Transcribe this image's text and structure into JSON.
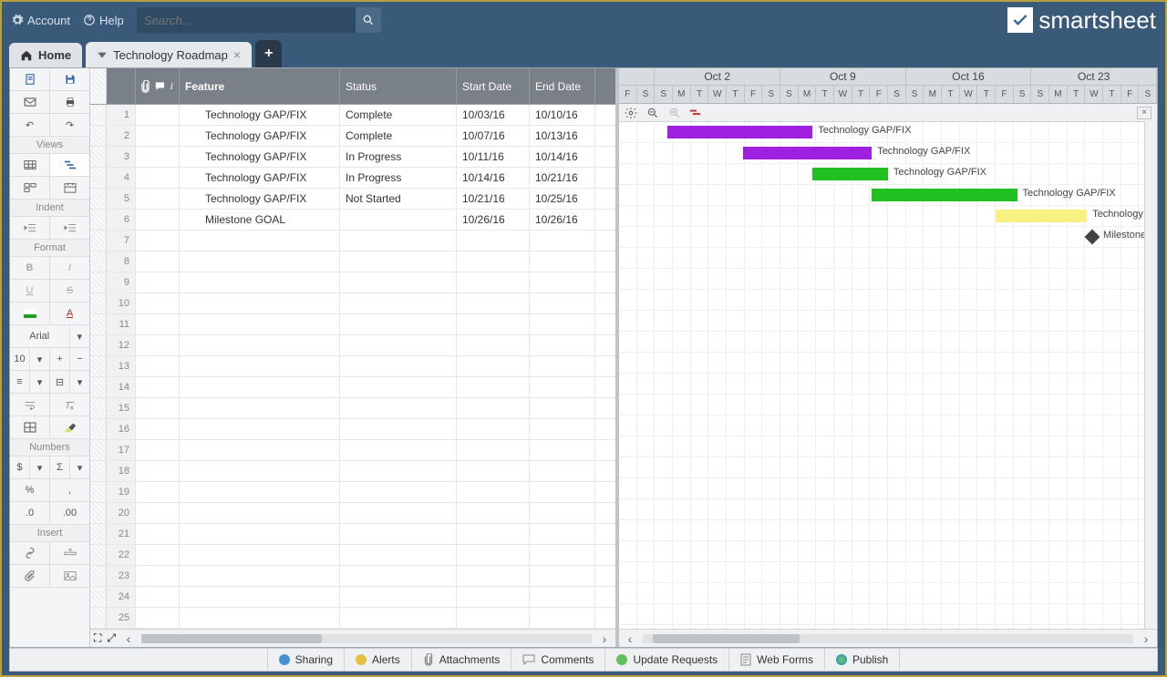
{
  "topbar": {
    "account": "Account",
    "help": "Help",
    "search_placeholder": "Search..."
  },
  "brand": {
    "name": "smartsheet"
  },
  "tabs": {
    "home": "Home",
    "sheet": "Technology Roadmap"
  },
  "sidebar": {
    "views_label": "Views",
    "indent_label": "Indent",
    "format_label": "Format",
    "numbers_label": "Numbers",
    "insert_label": "Insert",
    "font": "Arial",
    "fontsize": "10"
  },
  "grid": {
    "columns": {
      "feature": "Feature",
      "status": "Status",
      "start": "Start Date",
      "end": "End Date"
    },
    "rows": [
      {
        "n": 1,
        "feature": "Technology GAP/FIX",
        "status": "Complete",
        "start": "10/03/16",
        "end": "10/10/16"
      },
      {
        "n": 2,
        "feature": "Technology GAP/FIX",
        "status": "Complete",
        "start": "10/07/16",
        "end": "10/13/16"
      },
      {
        "n": 3,
        "feature": "Technology GAP/FIX",
        "status": "In Progress",
        "start": "10/11/16",
        "end": "10/14/16"
      },
      {
        "n": 4,
        "feature": "Technology GAP/FIX",
        "status": "In Progress",
        "start": "10/14/16",
        "end": "10/21/16"
      },
      {
        "n": 5,
        "feature": "Technology GAP/FIX",
        "status": "Not Started",
        "start": "10/21/16",
        "end": "10/25/16"
      },
      {
        "n": 6,
        "feature": "Milestone GOAL",
        "status": "",
        "start": "10/26/16",
        "end": "10/26/16"
      }
    ],
    "blank_rows_to": 25
  },
  "gantt": {
    "weeks": [
      "Oct 2",
      "Oct 9",
      "Oct 16",
      "Oct 23"
    ],
    "days": [
      "F",
      "S",
      "S",
      "M",
      "T",
      "W",
      "T",
      "F",
      "S",
      "S",
      "M",
      "T",
      "W",
      "T",
      "F",
      "S",
      "S",
      "M",
      "T",
      "W",
      "T",
      "F",
      "S",
      "S",
      "M",
      "T",
      "W",
      "T",
      "F",
      "S"
    ],
    "bars": [
      {
        "row": 0,
        "left_pct": 9,
        "width_pct": 27,
        "color": "#a020e0",
        "label": "Technology GAP/FIX"
      },
      {
        "row": 1,
        "left_pct": 23,
        "width_pct": 24,
        "color": "#a020e0",
        "label": "Technology GAP/FIX"
      },
      {
        "row": 2,
        "left_pct": 36,
        "width_pct": 14,
        "color": "#20c020",
        "label": "Technology GAP/FIX"
      },
      {
        "row": 3,
        "left_pct": 47,
        "width_pct": 27,
        "color": "#20c020",
        "label": "Technology GAP/FIX"
      },
      {
        "row": 4,
        "left_pct": 70,
        "width_pct": 17,
        "color": "#f8f080",
        "label": "Technology GAP/FIX",
        "label_cut": "Technology G"
      },
      {
        "row": 5,
        "left_pct": 87,
        "diamond": true,
        "label": "Milestone GOAL",
        "label_cut": "Milestone G"
      }
    ]
  },
  "bottom": {
    "sharing": "Sharing",
    "alerts": "Alerts",
    "attachments": "Attachments",
    "comments": "Comments",
    "update": "Update Requests",
    "webforms": "Web Forms",
    "publish": "Publish"
  }
}
